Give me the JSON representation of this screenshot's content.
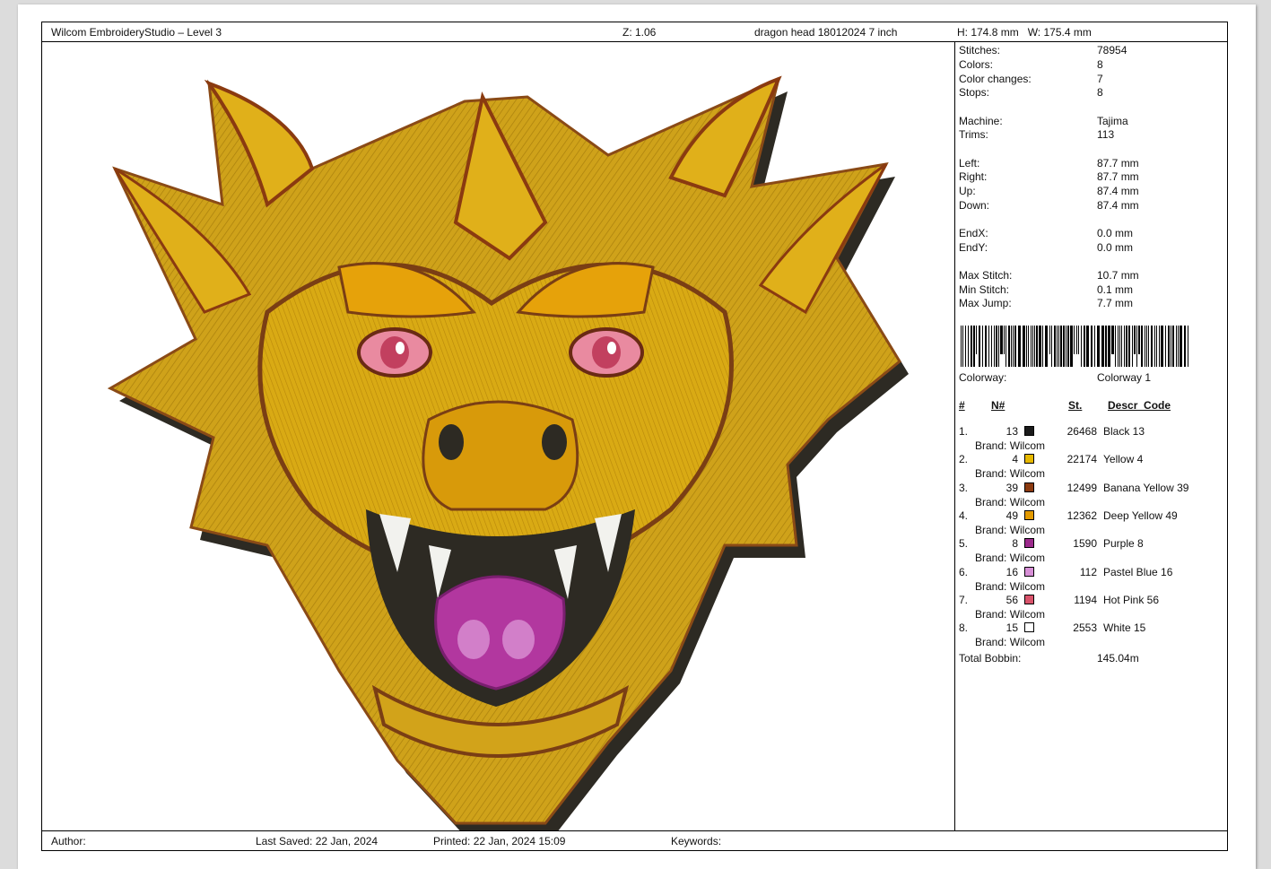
{
  "header": {
    "software": "Wilcom EmbroideryStudio – Level 3",
    "zoom": "Z: 1.06",
    "design_name": "dragon head 18012024 7 inch",
    "dimensions": "H: 174.8 mm   W: 175.4 mm"
  },
  "stats": [
    {
      "label": "Stitches:",
      "value": "78954"
    },
    {
      "label": "Colors:",
      "value": "8"
    },
    {
      "label": "Color changes:",
      "value": "7"
    },
    {
      "label": "Stops:",
      "value": "8"
    },
    {
      "label": "Machine:",
      "value": "Tajima"
    },
    {
      "label": "Trims:",
      "value": "113"
    },
    {
      "label": "Left:",
      "value": "87.7 mm"
    },
    {
      "label": "Right:",
      "value": "87.7 mm"
    },
    {
      "label": "Up:",
      "value": "87.4 mm"
    },
    {
      "label": "Down:",
      "value": "87.4 mm"
    },
    {
      "label": "EndX:",
      "value": "0.0 mm"
    },
    {
      "label": "EndY:",
      "value": "0.0 mm"
    },
    {
      "label": "Max Stitch:",
      "value": "10.7 mm"
    },
    {
      "label": "Min Stitch:",
      "value": "0.1 mm"
    },
    {
      "label": "Max Jump:",
      "value": "7.7 mm"
    }
  ],
  "colorway": {
    "label": "Colorway:",
    "value": "Colorway 1"
  },
  "color_table": {
    "headers": {
      "num": "#",
      "n": "N#",
      "st": "St.",
      "descr": "Descr  Code"
    },
    "rows": [
      {
        "index": "1.",
        "n": "13",
        "color": "#1a1a1a",
        "stitches": "26468",
        "desc": "Black 13",
        "brand": "Brand: Wilcom"
      },
      {
        "index": "2.",
        "n": "4",
        "color": "#e6b800",
        "stitches": "22174",
        "desc": "Yellow 4",
        "brand": "Brand: Wilcom"
      },
      {
        "index": "3.",
        "n": "39",
        "color": "#8b3a10",
        "stitches": "12499",
        "desc": "Banana Yellow 39",
        "brand": "Brand: Wilcom"
      },
      {
        "index": "4.",
        "n": "49",
        "color": "#e39a00",
        "stitches": "12362",
        "desc": "Deep Yellow 49",
        "brand": "Brand: Wilcom"
      },
      {
        "index": "5.",
        "n": "8",
        "color": "#9c2a8c",
        "stitches": "1590",
        "desc": "Purple 8",
        "brand": "Brand: Wilcom"
      },
      {
        "index": "6.",
        "n": "16",
        "color": "#d78fd6",
        "stitches": "112",
        "desc": "Pastel Blue 16",
        "brand": "Brand: Wilcom"
      },
      {
        "index": "7.",
        "n": "56",
        "color": "#d9536b",
        "stitches": "1194",
        "desc": "Hot Pink 56",
        "brand": "Brand: Wilcom"
      },
      {
        "index": "8.",
        "n": "15",
        "color": "#ffffff",
        "stitches": "2553",
        "desc": "White 15",
        "brand": "Brand: Wilcom"
      }
    ],
    "total_bobbin": {
      "label": "Total Bobbin:",
      "value": "145.04m"
    }
  },
  "footer": {
    "author": "Author:",
    "last_saved": "Last Saved: 22 Jan, 2024",
    "printed": "Printed: 22 Jan, 2024 15:09",
    "keywords": "Keywords:"
  }
}
